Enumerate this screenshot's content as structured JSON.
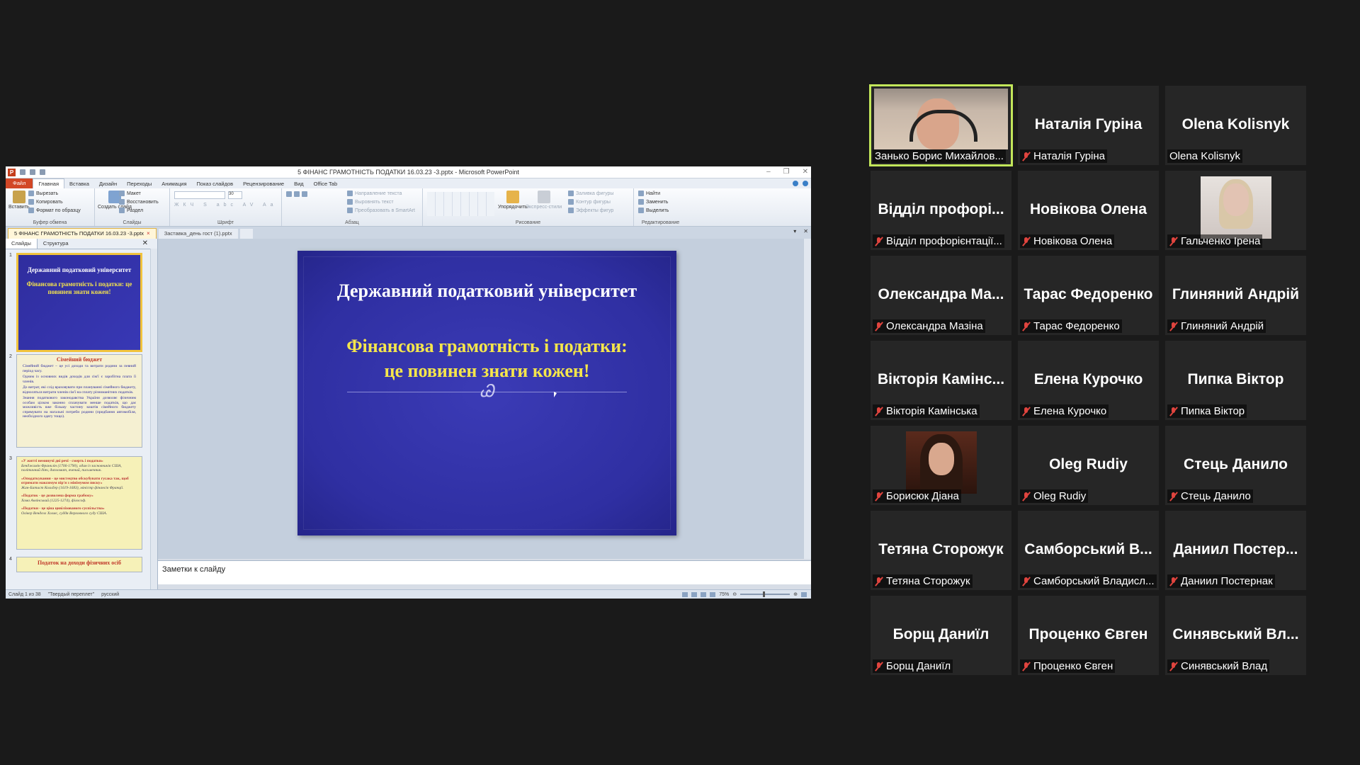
{
  "powerpoint": {
    "window_title": "5 ФІНАНС ГРАМОТНІСТЬ ПОДАТКИ 16.03.23 -3.pptx - Microsoft PowerPoint",
    "menu": [
      "Файл",
      "Главная",
      "Вставка",
      "Дизайн",
      "Переходы",
      "Анимация",
      "Показ слайдов",
      "Рецензирование",
      "Вид",
      "Office Tab"
    ],
    "ribbon": {
      "paste": "Вставить",
      "cut": "Вырезать",
      "copy": "Копировать",
      "format_painter": "Формат по образцу",
      "clipboard": "Буфер обмена",
      "new_slide": "Создать слайд",
      "layout": "Макет",
      "reset": "Восстановить",
      "section": "Раздел",
      "slides": "Слайды",
      "font_size": "30",
      "font": "Шрифт",
      "paragraph": "Абзац",
      "text_direction": "Направление текста",
      "align_text": "Выровнять текст",
      "smartart": "Преобразовать в SmartArt",
      "arrange": "Упорядочить",
      "quick_styles": "Экспресс-стили",
      "shape_fill": "Заливка фигуры",
      "shape_outline": "Контур фигуры",
      "shape_effects": "Эффекты фигур",
      "drawing": "Рисование",
      "find": "Найти",
      "replace": "Заменить",
      "select": "Выделить",
      "editing": "Редактирование"
    },
    "doc_tabs": [
      "5 ФІНАНС ГРАМОТНІСТЬ ПОДАТКИ 16.03.23 -3.pptx",
      "Заставка_день гост (1).pptx"
    ],
    "panel_tabs": [
      "Слайды",
      "Структура"
    ],
    "thumbnails": {
      "t1_title": "Державний податковий університет",
      "t1_sub": "Фінансова грамотність і податки: це повинен знати кожен!",
      "t2_head": "Сімейний бюджет",
      "t2_p1": "Сімейний бюджет – це усі доходи та витрати родини за певний період часу.",
      "t2_p2": "Одним із основних видів доходів для сім'ї є заробітна плата її членів.",
      "t2_p3": "До витрат, які слід враховувати при плануванні сімейного бюджету, відносяться витрати членів сім'ї на сплату різноманітних податків.",
      "t2_p4": "Знання податкового законодавства України дозволяє фізичним особам цілком законно сплачувати менше податків, що дає можливість вже більшу частину коштів сімейного бюджету спрямувати на нагальні потреби родини (придбання автомобіля, необхідного одягу тощо).",
      "t3_p1": "«У житті неминучі дві речі - смерть і податки»",
      "t3_a1": "Бенджамін Франклін (1706-1790), один із засновників США, політичний діяч, дипломат, вчений, письменник.",
      "t3_p2": "«Оподаткування - це мистецтво обскубувати гусака так, щоб отримати максимум пір'я з мінімумом писку»",
      "t3_a2": "Жан-Батист Кольбер (1619-1683), міністр фінансів Франції.",
      "t3_p3": "«Податок - це дозволена форма грабежу»",
      "t3_a3": "Хома Аквінський (1225-1274), філософ.",
      "t3_p4": "«Податки - це ціна цивілізованого суспільства»",
      "t3_a4": "Олівер Венделл Холмс, суддя Верховного суду США.",
      "t4_head": "Податок на доходи фізичних осіб"
    },
    "slide": {
      "title": "Державний податковий університет",
      "subtitle_line1": "Фінансова грамотність і податки:",
      "subtitle_line2": "це  повинен знати кожен!",
      "ornament": "Ꮚ"
    },
    "notes_placeholder": "Заметки к слайду",
    "status": {
      "slide_of": "Слайд 1 из 38",
      "theme": "\"Твердый переплет\"",
      "language": "русский",
      "zoom": "75%"
    }
  },
  "participants": [
    {
      "name": "Занько Борис Михайлов...",
      "video": "webcam",
      "active": true
    },
    {
      "name": "Наталія Гуріна",
      "display": "Наталія Гуріна",
      "muted": true
    },
    {
      "name": "Olena Kolisnyk",
      "display": "Olena Kolisnyk",
      "muted": false
    },
    {
      "name": "Відділ профорієнтації...",
      "display": "Відділ профорі...",
      "muted": true
    },
    {
      "name": "Новікова Олена",
      "display": "Новікова Олена",
      "muted": true
    },
    {
      "name": "Гальченко Ірена",
      "video": "webcam",
      "muted": true
    },
    {
      "name": "Олександра Мазіна",
      "display": "Олександра Ма...",
      "muted": true
    },
    {
      "name": "Тарас Федоренко",
      "display": "Тарас Федоренко",
      "muted": true
    },
    {
      "name": "Глиняний Андрій",
      "display": "Глиняний Андрій",
      "muted": true
    },
    {
      "name": "Вікторія Камінська",
      "display": "Вікторія Камінс...",
      "muted": true
    },
    {
      "name": "Елена Курочко",
      "display": "Елена Курочко",
      "muted": true
    },
    {
      "name": "Пипка Віктор",
      "display": "Пипка Віктор",
      "muted": true
    },
    {
      "name": "Борисюк Діана",
      "video": "webcam",
      "muted": true
    },
    {
      "name": "Oleg Rudiy",
      "display": "Oleg Rudiy",
      "muted": true
    },
    {
      "name": "Стець Данило",
      "display": "Стець Данило",
      "muted": true
    },
    {
      "name": "Тетяна Сторожук",
      "display": "Тетяна Сторожук",
      "muted": true
    },
    {
      "name": "Самборський Владисл...",
      "display": "Самборський В...",
      "muted": true
    },
    {
      "name": "Даниил Постернак",
      "display": "Даниил Постер...",
      "muted": true
    },
    {
      "name": "Борщ Даниїл",
      "display": "Борщ Даниїл",
      "muted": true
    },
    {
      "name": "Проценко Євген",
      "display": "Проценко Євген",
      "muted": true
    },
    {
      "name": "Синявський Влад",
      "display": "Синявський Вл...",
      "muted": true
    }
  ],
  "colors": {
    "slide_background": "#3232a8",
    "slide_title": "#ffffff",
    "slide_subtitle": "#f5e64b",
    "active_speaker_border": "#c3e75a",
    "muted_icon": "#e0443e",
    "file_tab": "#d24726"
  }
}
